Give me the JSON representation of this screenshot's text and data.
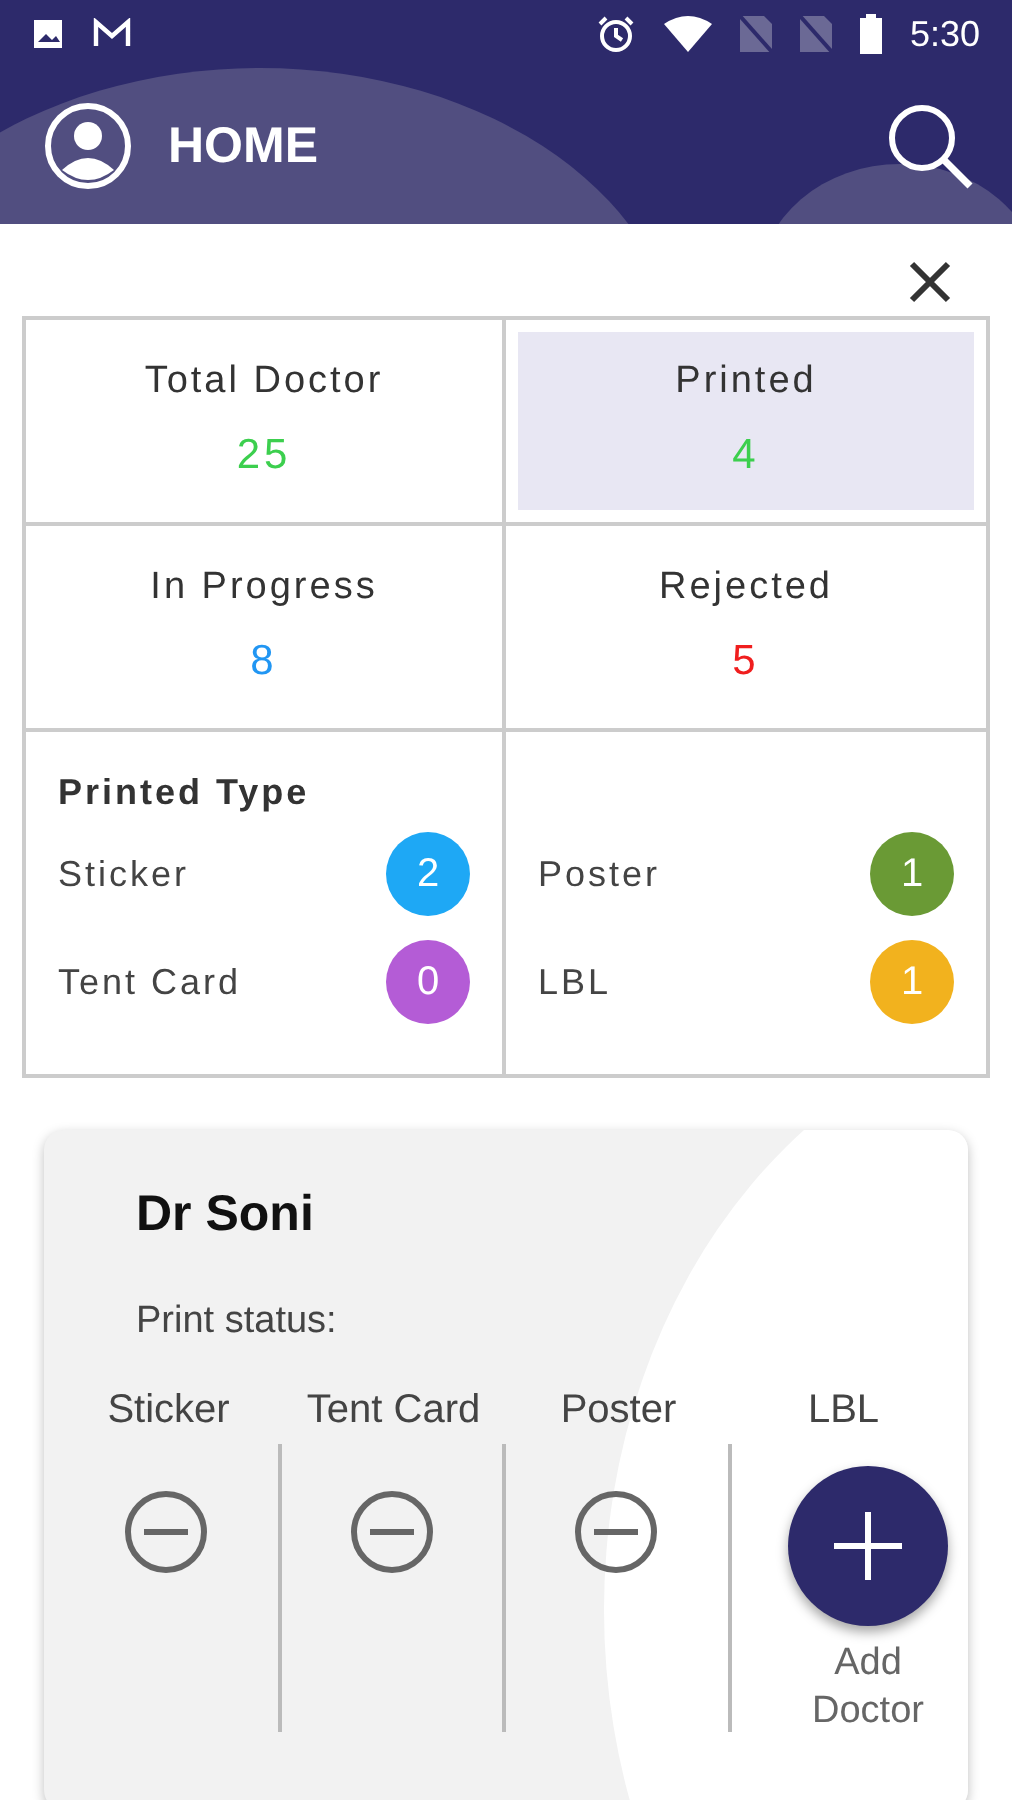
{
  "status_bar": {
    "time": "5:30"
  },
  "app_bar": {
    "title": "HOME"
  },
  "stats": [
    {
      "label": "Total Doctor",
      "value": "25",
      "color": "#3ccf4e",
      "selected": false
    },
    {
      "label": "Printed",
      "value": "4",
      "color": "#3ccf4e",
      "selected": true
    },
    {
      "label": "In Progress",
      "value": "8",
      "color": "#2196f3",
      "selected": false
    },
    {
      "label": "Rejected",
      "value": "5",
      "color": "#f01e1e",
      "selected": false
    }
  ],
  "printed_type": {
    "title": "Printed Type",
    "types": [
      {
        "label": "Sticker",
        "count": "2",
        "color": "#1ea8f5"
      },
      {
        "label": "Poster",
        "count": "1",
        "color": "#6a9a35"
      },
      {
        "label": "Tent Card",
        "count": "0",
        "color": "#b45cd6"
      },
      {
        "label": "LBL",
        "count": "1",
        "color": "#f2b21e"
      }
    ]
  },
  "doctor_card": {
    "name": "Dr Soni",
    "status_label": "Print status:",
    "columns": [
      {
        "label": "Sticker",
        "kind": "pending"
      },
      {
        "label": "Tent Card",
        "kind": "pending"
      },
      {
        "label": "Poster",
        "kind": "pending"
      },
      {
        "label": "LBL",
        "kind": "covered"
      }
    ]
  },
  "fab": {
    "label": "Add Doctor"
  }
}
